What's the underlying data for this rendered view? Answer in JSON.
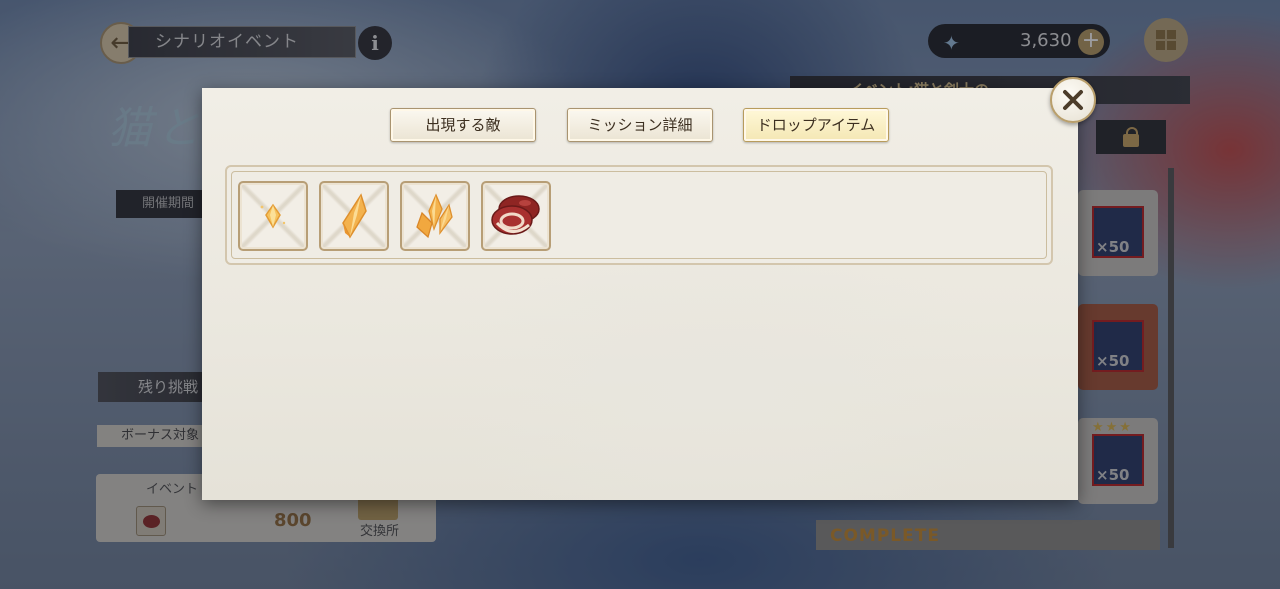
{
  "background": {
    "header_title": "シナリオイベント",
    "info_label": "i",
    "event_logo_text": "猫と",
    "period_label": "開催期間",
    "remaining_label": "残り挑戦",
    "bonus_label": "ボーナス対象",
    "event_item_label": "イベント",
    "event_item_count": "800",
    "exchange_label": "交換所",
    "currency_value": "3,630",
    "event_banner": "イベント:猫と剣士の",
    "reward_multiplier": "×50",
    "complete_label": "COMPLETE"
  },
  "dialog": {
    "tabs": [
      {
        "label": "出現する敵",
        "active": false
      },
      {
        "label": "ミッション詳細",
        "active": false
      },
      {
        "label": "ドロップアイテム",
        "active": true
      }
    ],
    "drop_items": [
      {
        "icon": "small-crystal-icon"
      },
      {
        "icon": "crystal-shard-icon"
      },
      {
        "icon": "crystal-cluster-icon"
      },
      {
        "icon": "meat-icon"
      }
    ]
  },
  "colors": {
    "dialog_bg": "#ece9e0",
    "tab_border": "#a99470",
    "active_tab_bg": "#f4e7b4",
    "crystal": "#f0b24a",
    "meat": "#9e2f2e"
  }
}
